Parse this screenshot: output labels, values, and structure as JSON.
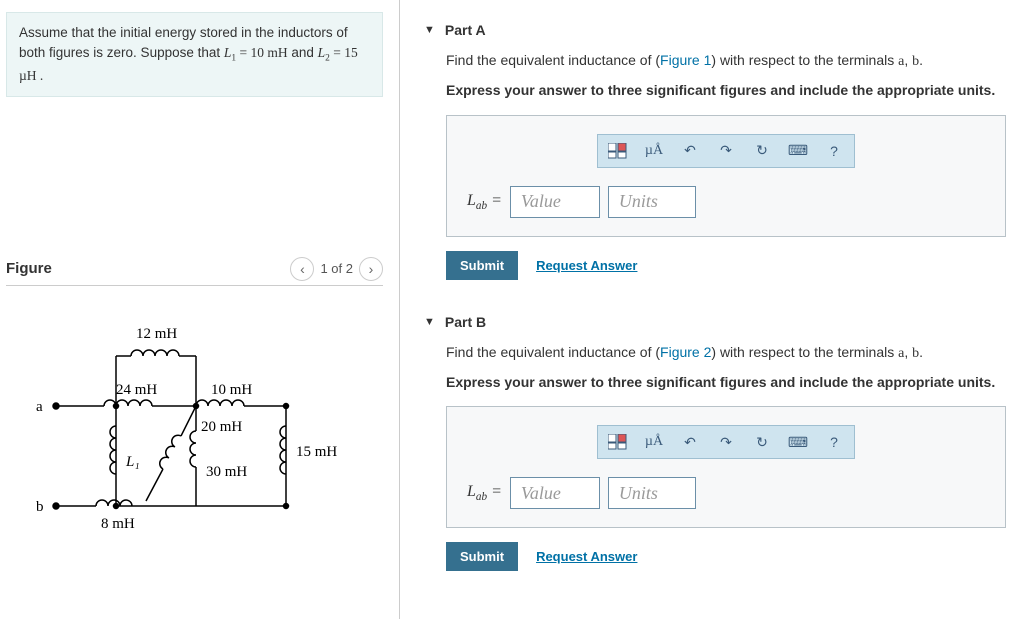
{
  "problem": {
    "line1": "Assume that the initial energy stored in the inductors of both figures is zero. Suppose that ",
    "L1_lhs": "L",
    "L1_sub": "1",
    "L1_rhs": " = 10  mH",
    "mid": " and ",
    "L2_lhs": "L",
    "L2_sub": "2",
    "L2_rhs": " = 15  µH ."
  },
  "figure": {
    "title": "Figure",
    "pager": "1 of 2",
    "labels": {
      "top": "12 mH",
      "left": "24 mH",
      "right_top": "10 mH",
      "mid": "20 mH",
      "L1": "L₁",
      "bottom_mid": "30 mH",
      "right": "15 mH",
      "bottom": "8 mH",
      "a": "a",
      "b": "b"
    }
  },
  "partA": {
    "title": "Part A",
    "prompt_pre": "Find the equivalent inductance of (",
    "fig_link": "Figure 1",
    "prompt_post": ") with respect to the terminals ",
    "term_a": "a",
    "term_sep": ", ",
    "term_b": "b",
    "term_end": ".",
    "instruction": "Express your answer to three significant figures and include the appropriate units.",
    "var_L": "L",
    "var_sub": "ab",
    "eq": " =",
    "value_ph": "Value",
    "units_ph": "Units",
    "submit": "Submit",
    "request": "Request Answer"
  },
  "partB": {
    "title": "Part B",
    "prompt_pre": "Find the equivalent inductance of (",
    "fig_link": "Figure 2",
    "prompt_post": ") with respect to the terminals ",
    "term_a": "a",
    "term_sep": ", ",
    "term_b": "b",
    "term_end": ".",
    "instruction": "Express your answer to three significant figures and include the appropriate units.",
    "var_L": "L",
    "var_sub": "ab",
    "eq": " =",
    "value_ph": "Value",
    "units_ph": "Units",
    "submit": "Submit",
    "request": "Request Answer"
  },
  "toolbar": {
    "units_label": "µÅ",
    "help": "?"
  }
}
